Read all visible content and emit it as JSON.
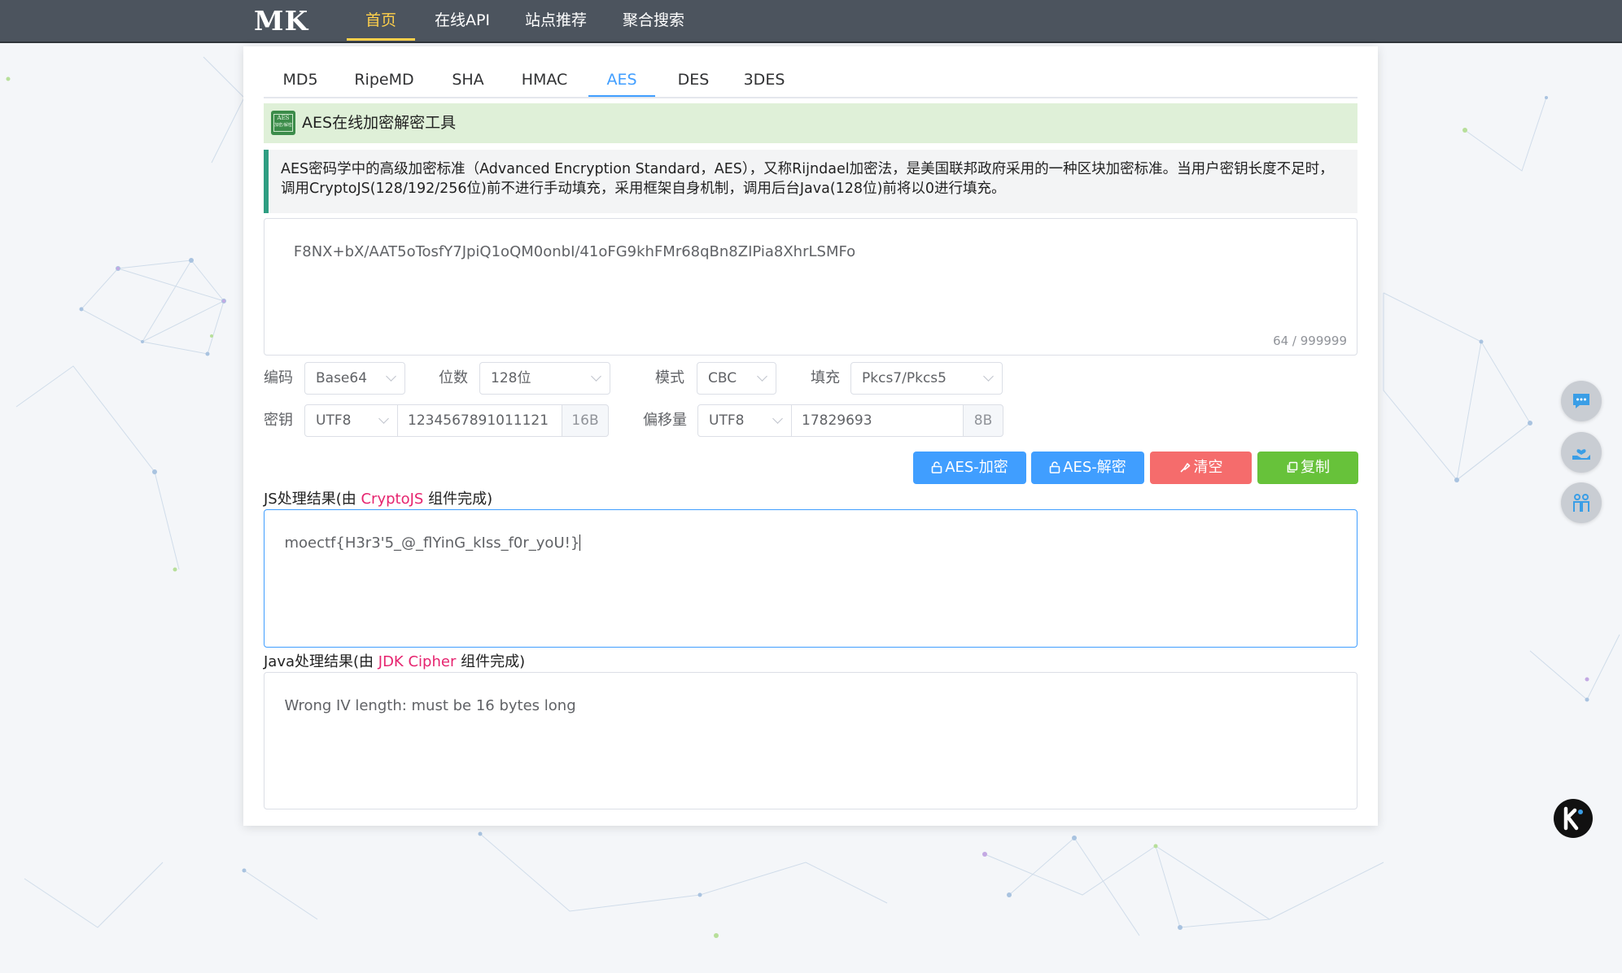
{
  "nav": {
    "logo": "MK",
    "items": [
      "首页",
      "在线API",
      "站点推荐",
      "聚合搜索"
    ],
    "active_index": 0
  },
  "tabs": {
    "items": [
      "MD5",
      "RipeMD",
      "SHA",
      "HMAC",
      "AES",
      "DES",
      "3DES"
    ],
    "active_index": 4
  },
  "tool": {
    "title": "AES在线加密解密工具",
    "icon_line1": "AES",
    "icon_line2": "加密/解密",
    "description": "AES密码学中的高级加密标准（Advanced Encryption Standard，AES），又称Rijndael加密法，是美国联邦政府采用的一种区块加密标准。当用户密钥长度不足时，调用CryptoJS(128/192/256位)前不进行手动填充，采用框架自身机制，调用后台Java(128位)前将以0进行填充。"
  },
  "input": {
    "value": "F8NX+bX/AAT5oTosfY7JpiQ1oQM0onbI/41oFG9khFMr68qBn8ZIPia8XhrLSMFo",
    "counter": "64 / 999999"
  },
  "options": {
    "encoding_label": "编码",
    "encoding_value": "Base64",
    "bits_label": "位数",
    "bits_value": "128位",
    "mode_label": "模式",
    "mode_value": "CBC",
    "padding_label": "填充",
    "padding_value": "Pkcs7/Pkcs5",
    "key_label": "密钥",
    "key_encoding": "UTF8",
    "key_value": "1234567891011121",
    "key_size": "16B",
    "iv_label": "偏移量",
    "iv_encoding": "UTF8",
    "iv_value": "17829693",
    "iv_size": "8B"
  },
  "buttons": {
    "encrypt": "AES-加密",
    "decrypt": "AES-解密",
    "clear": "清空",
    "copy": "复制"
  },
  "js_result": {
    "label_prefix": "JS处理结果(由 ",
    "label_lib": "CryptoJS",
    "label_suffix": " 组件完成)",
    "value": "moectf{H3r3'5_@_flYinG_kIss_f0r_yoU!}"
  },
  "java_result": {
    "label_prefix": "Java处理结果(由 ",
    "label_lib": "JDK Cipher",
    "label_suffix": " 组件完成)",
    "value": "Wrong IV length: must be 16 bytes long"
  },
  "colors": {
    "nav_bg": "#4c545e",
    "nav_active": "#ffd04b",
    "tab_active": "#409eff",
    "btn_blue": "#409eff",
    "btn_red": "#f56c6c",
    "btn_green": "#67c23a",
    "lib_highlight": "#e6246f",
    "title_bg": "#dff0d8",
    "desc_border": "#2f9e82"
  },
  "side_icons": [
    "chat-bubble-icon",
    "heart-hand-icon",
    "people-icon",
    "k-logo-icon"
  ]
}
